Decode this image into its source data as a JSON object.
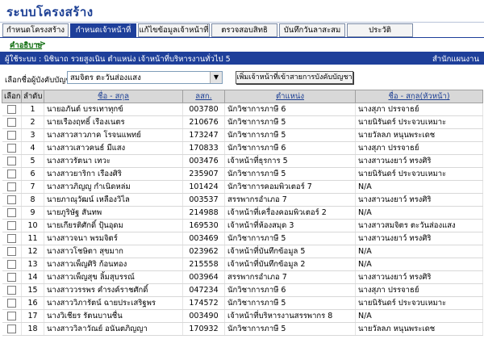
{
  "app": {
    "title": "ระบบโครงสร้าง"
  },
  "tabs": [
    {
      "label": "กำหนดโครงสร้าง",
      "active": false
    },
    {
      "label": "กำหนดเจ้าหน้าที่",
      "active": true
    },
    {
      "label": "แก้ไขข้อมูลเจ้าหน้าที่",
      "active": false
    },
    {
      "label": "ตรวจสอบสิทธิ",
      "active": false
    },
    {
      "label": "บันทึกวันลาสะสม",
      "active": false
    },
    {
      "label": "ประวัติ",
      "active": false
    }
  ],
  "subnav": {
    "link": "คำอธิบาย",
    "arrow": "->"
  },
  "info": {
    "user": "ผู้ใช้ระบบ : นิชินาถ รวยสูงเนิน  ตำแหน่ง เจ้าหน้าที่บริหารงานทั่วไป 5",
    "department": "สำนักแผนงาน"
  },
  "filter": {
    "label": "เลือกชื่อผู้บังคับบัญชา :",
    "selected": "สมจิตร ตะวันส่องแสง",
    "button": "เพิ่มเจ้าหน้าที่เข้าสายการบังคับบัญชา"
  },
  "table": {
    "headers": [
      "เลือก",
      "ลำดับ",
      "ชื่อ - สกุล",
      "ลสก.",
      "ตำแหน่ง",
      "ชื่อ - สกุล(หัวหน้า)"
    ],
    "rows": [
      [
        "1",
        "นายอภันต์   บรรเทาทุกข์",
        "003780",
        "นักวิชาการภาษี  6",
        "นางสุภา ปรรจาธย์"
      ],
      [
        "2",
        "นายเรืองฤทธิ์   เรืองเนตร",
        "210676",
        "นักวิชาการภาษี  5",
        "นายนิรันดร์ ประจวบเหมาะ"
      ],
      [
        "3",
        "นางสาวสาวภาค  โรจนแพทย์",
        "173247",
        "นักวิชาการภาษี  5",
        "นายวัลลภ หนุนพระเดช"
      ],
      [
        "4",
        "นางสาวเสาวคนธ์   มีแสง",
        "170833",
        "นักวิชาการภาษี  6",
        "นางสุภา ปรรจาธย์"
      ],
      [
        "5",
        "นางสาวรัตนา   เทวะ",
        "003476",
        "เจ้าหน้าที่ธุรการ  5",
        "นางสาวนงยาว์ ทรงศิริ"
      ],
      [
        "6",
        "นางสาวยาริกา  เรืองศิริ",
        "235907",
        "นักวิชาการภาษี  5",
        "นายนิรันดร์ ประจวบเหมาะ"
      ],
      [
        "7",
        "นางสาวภิญญู  กำเนิดหล่ม",
        "101424",
        "นักวิชาการคอมพิวเตอร์  7",
        "N/A"
      ],
      [
        "8",
        "นายภาณุวัฒน์  เหลืองวิไล",
        "003537",
        "สรรพากรอำเภอ  7",
        "นางสาวนงยาว์ ทรงศิริ"
      ],
      [
        "9",
        "นายภูริษัฐ   สันทพ",
        "214988",
        "เจ้าหน้าที่เครื่องคอมพิวเตอร์  2",
        "N/A"
      ],
      [
        "10",
        "นายเกียรติศักดิ์   ปุ้นอุดม",
        "169530",
        "เจ้าหน้าที่ห้องสมุด  3",
        "นางสาวสมจิตร ตะวันส่องแสง"
      ],
      [
        "11",
        "นางสาวจนา   พรมจิตร์",
        "003469",
        "นักวิชาการภาษี  5",
        "นางสาวนงยาว์ ทรงศิริ"
      ],
      [
        "12",
        "นางสาวโชษิตา   สุขมาก",
        "023962",
        "เจ้าหน้าที่บันทึกข้อมูล  5",
        "N/A"
      ],
      [
        "13",
        "นางสาวเพ็ญศิริ  ก้อนทอง",
        "215558",
        "เจ้าหน้าที่บันทึกข้อมูล  2",
        "N/A"
      ],
      [
        "14",
        "นางสาวเพ็ญสุข   ลิ้มสุบรรณ์",
        "003964",
        "สรรพากรอำเภอ  7",
        "นางสาวนงยาว์ ทรงศิริ"
      ],
      [
        "15",
        "นางสาววรรพร   คำรงค์ราชศักดิ์",
        "047234",
        "นักวิชาการภาษี  6",
        "นางสุภา ปรรจาธย์"
      ],
      [
        "16",
        "นางสาววิภารัตน์   ฉายประเสริฐพร",
        "174572",
        "นักวิชาการภาษี  5",
        "นายนิรันดร์ ประจวบเหมาะ"
      ],
      [
        "17",
        "นางวิเชียร   รัตนบานชื่น",
        "003490",
        "เจ้าหน้าที่บริหารงานสรรพากร  8",
        "N/A"
      ],
      [
        "18",
        "นางสาววิลาวัณย์   อนันตภิญญา",
        "170932",
        "นักวิชาการภาษี  5",
        "นายวัลลภ หนุนพระเดช"
      ]
    ]
  }
}
